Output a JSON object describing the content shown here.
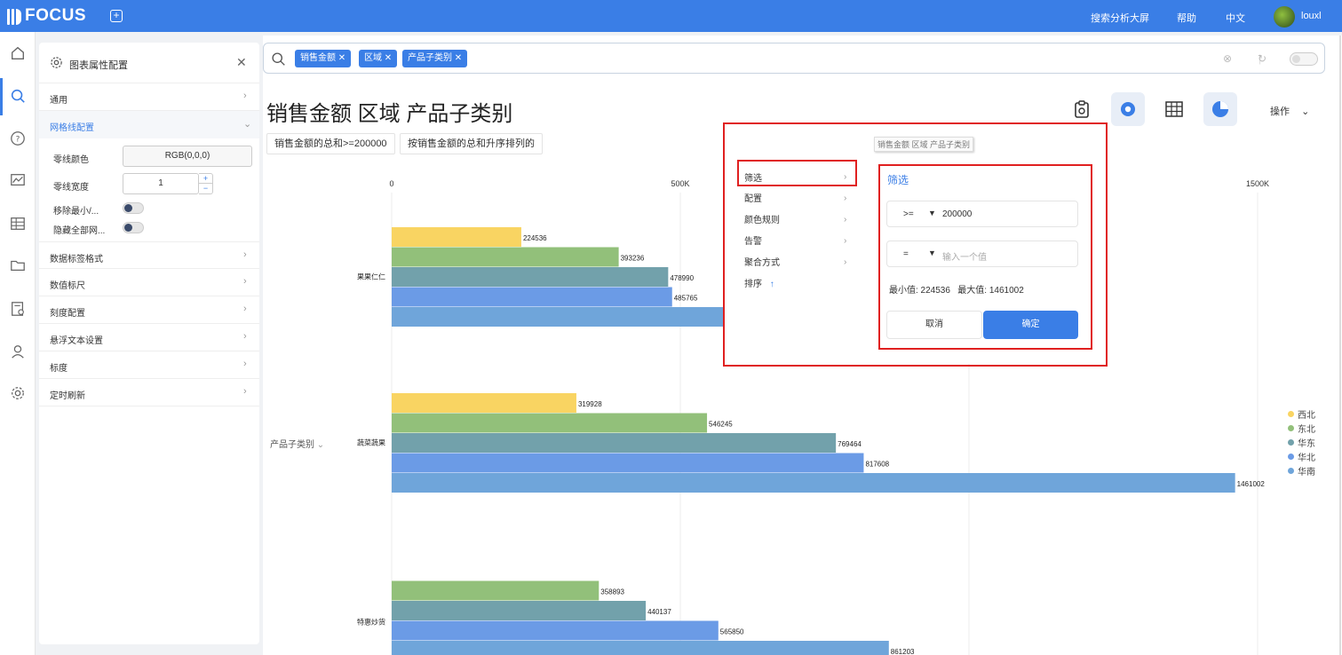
{
  "topbar": {
    "logo": "FOCUS",
    "links": [
      "搜索分析大屏",
      "帮助",
      "中文"
    ],
    "username": "louxl"
  },
  "left_nav": [
    "home-icon",
    "search-icon",
    "help-icon",
    "dashboard-icon",
    "table-icon",
    "folder-icon",
    "data-source-icon",
    "user-icon",
    "settings-icon"
  ],
  "config_panel": {
    "title": "图表属性配置",
    "sections": [
      {
        "label": "通用"
      },
      {
        "label": "网格线配置"
      },
      {
        "label": "数据标签格式"
      },
      {
        "label": "数值标尺"
      },
      {
        "label": "刻度配置"
      },
      {
        "label": "悬浮文本设置"
      },
      {
        "label": "标度"
      },
      {
        "label": "定时刷新"
      }
    ],
    "grid": {
      "zero_line_color_label": "零线颜色",
      "zero_line_color_value": "RGB(0,0,0)",
      "zero_line_width_label": "零线宽度",
      "zero_line_width_value": "1",
      "remove_minmax_label": "移除最小/...",
      "hide_all_grid_label": "隐藏全部网..."
    }
  },
  "search": {
    "tags": [
      "销售金额",
      "区域",
      "产品子类别"
    ]
  },
  "page_title": "销售金额 区域 产品子类别",
  "filter_chips": [
    "销售金额的总和>=200000",
    "按销售金额的总和升序排列的"
  ],
  "operations_label": "操作",
  "menu": {
    "tooltip": "销售金额 区域 产品子类别",
    "items": [
      "筛选",
      "配置",
      "颜色规则",
      "告警",
      "聚合方式",
      "排序"
    ],
    "sort_arrow": "↑"
  },
  "filter_popup": {
    "title": "筛选",
    "row1": {
      "operator": ">=",
      "value": "200000"
    },
    "row2": {
      "operator": "=",
      "placeholder": "输入一个值"
    },
    "min_label": "最小值: 224536",
    "max_label": "最大值: 1461002",
    "cancel": "取消",
    "ok": "确定"
  },
  "chart_data": {
    "type": "bar",
    "orientation": "horizontal",
    "ylabel": "产品子类别",
    "x_ticks": [
      "0",
      "500K",
      "1500K"
    ],
    "xlim": [
      0,
      1500000
    ],
    "categories": [
      "果果仁仁",
      "蔬菜蔬果",
      "特惠炒货"
    ],
    "series": [
      {
        "name": "西北",
        "color": "#f9d462",
        "values": [
          224536,
          319928,
          null
        ]
      },
      {
        "name": "东北",
        "color": "#92c07a",
        "values": [
          393236,
          546245,
          358893
        ]
      },
      {
        "name": "华东",
        "color": "#72a1ab",
        "values": [
          478990,
          769464,
          440137
        ]
      },
      {
        "name": "华北",
        "color": "#6b9be6",
        "values": [
          485765,
          817608,
          565850
        ]
      },
      {
        "name": "华南",
        "color": "#6fa5da",
        "values": [
          null,
          1461002,
          861203
        ]
      }
    ],
    "legend_position": "right"
  }
}
